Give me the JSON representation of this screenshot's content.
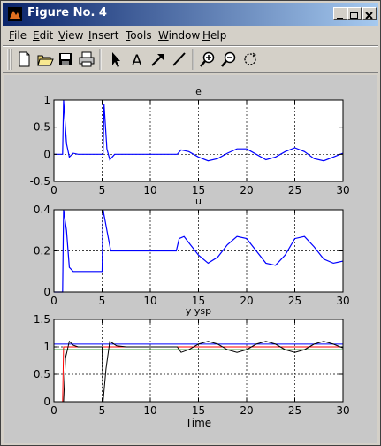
{
  "window": {
    "title": "Figure No. 4"
  },
  "menu": [
    {
      "label": "File",
      "key": "F",
      "rest": "ile"
    },
    {
      "label": "Edit",
      "key": "E",
      "rest": "dit"
    },
    {
      "label": "View",
      "key": "V",
      "rest": "iew"
    },
    {
      "label": "Insert",
      "key": "I",
      "rest": "nsert"
    },
    {
      "label": "Tools",
      "key": "T",
      "rest": "ools"
    },
    {
      "label": "Window",
      "key": "W",
      "rest": "indow"
    },
    {
      "label": "Help",
      "key": "H",
      "rest": "elp"
    }
  ],
  "toolbar": [
    "new-file-icon",
    "open-folder-icon",
    "save-icon",
    "print-icon",
    "pointer-arrow-icon",
    "text-A-icon",
    "arrow-icon",
    "line-icon",
    "zoom-in-icon",
    "zoom-out-icon",
    "rotate-icon"
  ],
  "chart_data": [
    {
      "type": "line",
      "title": "e",
      "xlabel": "",
      "ylabel": "",
      "xlim": [
        0,
        30
      ],
      "ylim": [
        -0.5,
        1
      ],
      "xticks": [
        0,
        5,
        10,
        15,
        20,
        25,
        30
      ],
      "yticks": [
        -0.5,
        0,
        0.5,
        1
      ],
      "ytick_labels": [
        "-0.5",
        "0",
        "0.5",
        "1"
      ],
      "grid": true,
      "series": [
        {
          "color": "#0000ff",
          "points": [
            [
              0,
              0
            ],
            [
              0.9,
              0
            ],
            [
              1.0,
              1.0
            ],
            [
              1.3,
              0.2
            ],
            [
              1.6,
              -0.05
            ],
            [
              2.0,
              0.02
            ],
            [
              2.5,
              0
            ],
            [
              5.1,
              0
            ],
            [
              5.2,
              0.92
            ],
            [
              5.5,
              0.1
            ],
            [
              5.8,
              -0.1
            ],
            [
              6.3,
              0
            ],
            [
              12.8,
              0
            ],
            [
              13.2,
              0.08
            ],
            [
              14,
              0.05
            ],
            [
              15,
              -0.05
            ],
            [
              16,
              -0.12
            ],
            [
              17,
              -0.08
            ],
            [
              18,
              0.02
            ],
            [
              19,
              0.1
            ],
            [
              20,
              0.1
            ],
            [
              21,
              0
            ],
            [
              22,
              -0.1
            ],
            [
              23,
              -0.05
            ],
            [
              24,
              0.05
            ],
            [
              25,
              0.12
            ],
            [
              26,
              0.05
            ],
            [
              27,
              -0.08
            ],
            [
              28,
              -0.12
            ],
            [
              29,
              -0.05
            ],
            [
              30,
              0.02
            ]
          ]
        }
      ]
    },
    {
      "type": "line",
      "title": "u",
      "xlabel": "",
      "ylabel": "",
      "xlim": [
        0,
        30
      ],
      "ylim": [
        0,
        0.4
      ],
      "xticks": [
        0,
        5,
        10,
        15,
        20,
        25,
        30
      ],
      "yticks": [
        0,
        0.2,
        0.4
      ],
      "ytick_labels": [
        "0",
        "0.2",
        "0.4"
      ],
      "grid": true,
      "series": [
        {
          "color": "#0000ff",
          "points": [
            [
              0,
              0
            ],
            [
              0.9,
              0
            ],
            [
              1.0,
              0.4
            ],
            [
              1.3,
              0.3
            ],
            [
              1.6,
              0.12
            ],
            [
              2.0,
              0.1
            ],
            [
              5.0,
              0.1
            ],
            [
              5.1,
              0.4
            ],
            [
              5.5,
              0.3
            ],
            [
              5.9,
              0.2
            ],
            [
              6.5,
              0.2
            ],
            [
              12.7,
              0.2
            ],
            [
              13.0,
              0.26
            ],
            [
              13.5,
              0.27
            ],
            [
              14,
              0.24
            ],
            [
              15,
              0.18
            ],
            [
              16,
              0.14
            ],
            [
              17,
              0.17
            ],
            [
              18,
              0.23
            ],
            [
              19,
              0.27
            ],
            [
              20,
              0.26
            ],
            [
              21,
              0.2
            ],
            [
              22,
              0.14
            ],
            [
              23,
              0.13
            ],
            [
              24,
              0.18
            ],
            [
              25,
              0.26
            ],
            [
              26,
              0.27
            ],
            [
              27,
              0.22
            ],
            [
              28,
              0.16
            ],
            [
              29,
              0.14
            ],
            [
              30,
              0.15
            ]
          ]
        }
      ]
    },
    {
      "type": "line",
      "title": "y ysp",
      "xlabel": "Time",
      "ylabel": "",
      "xlim": [
        0,
        30
      ],
      "ylim": [
        0,
        1.5
      ],
      "xticks": [
        0,
        5,
        10,
        15,
        20,
        25,
        30
      ],
      "yticks": [
        0,
        0.5,
        1,
        1.5
      ],
      "ytick_labels": [
        "0",
        "0.5",
        "1",
        "1.5"
      ],
      "grid": true,
      "series": [
        {
          "color": "#ff0000",
          "points": [
            [
              0,
              0
            ],
            [
              0.9,
              0
            ],
            [
              1.0,
              1.0
            ],
            [
              30,
              1.0
            ]
          ]
        },
        {
          "color": "#0000ff",
          "points": [
            [
              0,
              1.05
            ],
            [
              30,
              1.05
            ]
          ]
        },
        {
          "color": "#008000",
          "points": [
            [
              0,
              0.95
            ],
            [
              30,
              0.95
            ]
          ]
        },
        {
          "color": "#000000",
          "points": [
            [
              0,
              0
            ],
            [
              1.0,
              0
            ],
            [
              1.2,
              0.8
            ],
            [
              1.6,
              1.1
            ],
            [
              2.0,
              1.03
            ],
            [
              2.5,
              1.0
            ],
            [
              5.0,
              1.0
            ],
            [
              5.1,
              0
            ],
            [
              5.4,
              0.6
            ],
            [
              5.8,
              1.1
            ],
            [
              6.5,
              1.02
            ],
            [
              7.5,
              1.0
            ],
            [
              12.8,
              1.0
            ],
            [
              13.2,
              0.9
            ],
            [
              14,
              0.95
            ],
            [
              15,
              1.05
            ],
            [
              16,
              1.1
            ],
            [
              17,
              1.05
            ],
            [
              18,
              0.95
            ],
            [
              19,
              0.9
            ],
            [
              20,
              0.95
            ],
            [
              21,
              1.05
            ],
            [
              22,
              1.1
            ],
            [
              23,
              1.05
            ],
            [
              24,
              0.95
            ],
            [
              25,
              0.9
            ],
            [
              26,
              0.95
            ],
            [
              27,
              1.05
            ],
            [
              28,
              1.1
            ],
            [
              29,
              1.05
            ],
            [
              30,
              0.98
            ]
          ]
        }
      ]
    }
  ]
}
